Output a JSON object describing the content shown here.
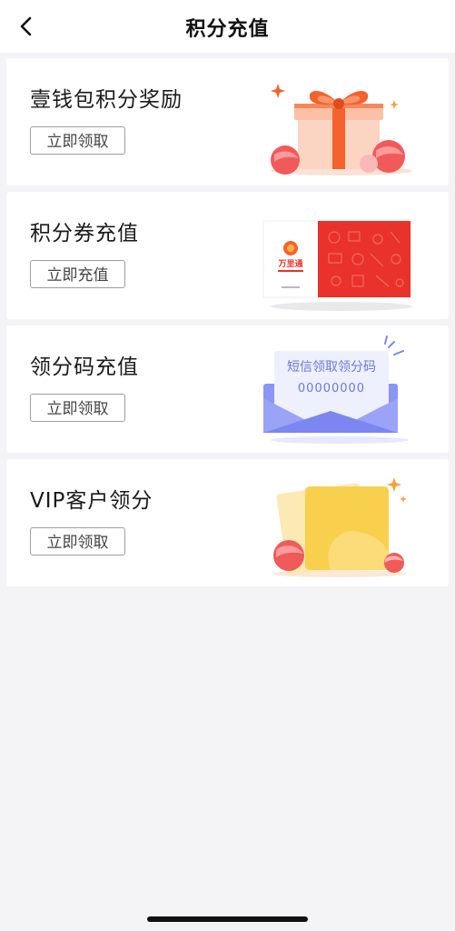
{
  "header": {
    "title": "积分充值"
  },
  "cards": [
    {
      "title": "壹钱包积分奖励",
      "button": "立即领取"
    },
    {
      "title": "积分券充值",
      "button": "立即充值",
      "card_logo_text": "万里通"
    },
    {
      "title": "领分码充值",
      "button": "立即领取",
      "envelope_title": "短信领取领分码",
      "envelope_code": "00000000"
    },
    {
      "title": "VIP客户领分",
      "button": "立即领取"
    }
  ],
  "icons": {
    "back": "chevron-left-icon",
    "gift": "gift-box-icon",
    "coupon": "coupon-card-icon",
    "envelope": "sms-envelope-icon",
    "vip": "vip-card-icon"
  },
  "colors": {
    "background": "#f4f3f6",
    "card": "#ffffff",
    "gift_orange": "#f5622d",
    "coupon_red": "#e8322b",
    "envelope_blue": "#7b86f0",
    "vip_yellow": "#f9cf4e"
  }
}
